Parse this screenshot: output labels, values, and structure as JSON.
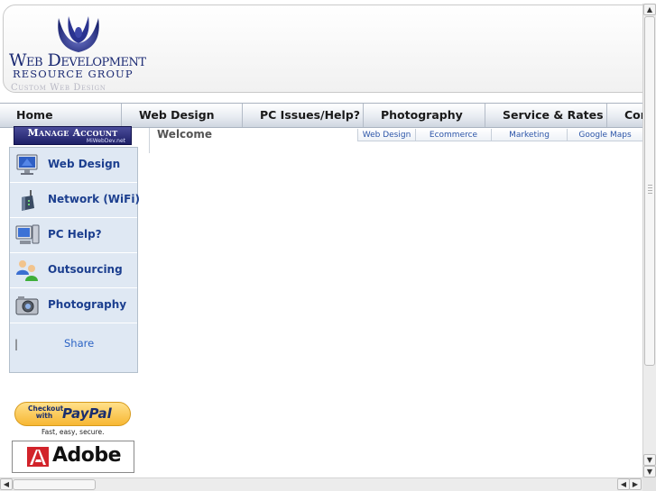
{
  "header": {
    "logo_line1": "Web Development",
    "logo_line2": "RESOURCE GROUP",
    "tagline": "Custom Web Design"
  },
  "nav": {
    "items": [
      {
        "label": "Home"
      },
      {
        "label": "Web Design"
      },
      {
        "label": "PC Issues/Help?"
      },
      {
        "label": "Photography"
      },
      {
        "label": "Service & Rates"
      },
      {
        "label": "Cor"
      }
    ]
  },
  "manage_account": {
    "label": "Manage Account",
    "sublabel": "MiWebDev.net"
  },
  "sidebar": {
    "items": [
      {
        "label": "Web Design",
        "icon": "monitor-icon"
      },
      {
        "label": "Network (WiFi)",
        "icon": "wifi-router-icon"
      },
      {
        "label": "PC Help?",
        "icon": "computer-icon"
      },
      {
        "label": "Outsourcing",
        "icon": "users-icon"
      },
      {
        "label": "Photography",
        "icon": "camera-icon"
      }
    ],
    "share_pipe": "|",
    "share_label": "Share"
  },
  "main": {
    "welcome": "Welcome",
    "subtabs": [
      {
        "label": "Web Design"
      },
      {
        "label": "Ecommerce"
      },
      {
        "label": "Marketing"
      },
      {
        "label": "Google Maps"
      }
    ]
  },
  "badges": {
    "paypal_checkout": "Checkout with",
    "paypal_word": "PayPal",
    "paypal_sub": "Fast, easy, secure.",
    "adobe_word": "Adobe"
  },
  "colors": {
    "brand_navy": "#1b2a73",
    "link_blue": "#1c3f8f",
    "sidebar_bg": "#dfe8f3"
  }
}
